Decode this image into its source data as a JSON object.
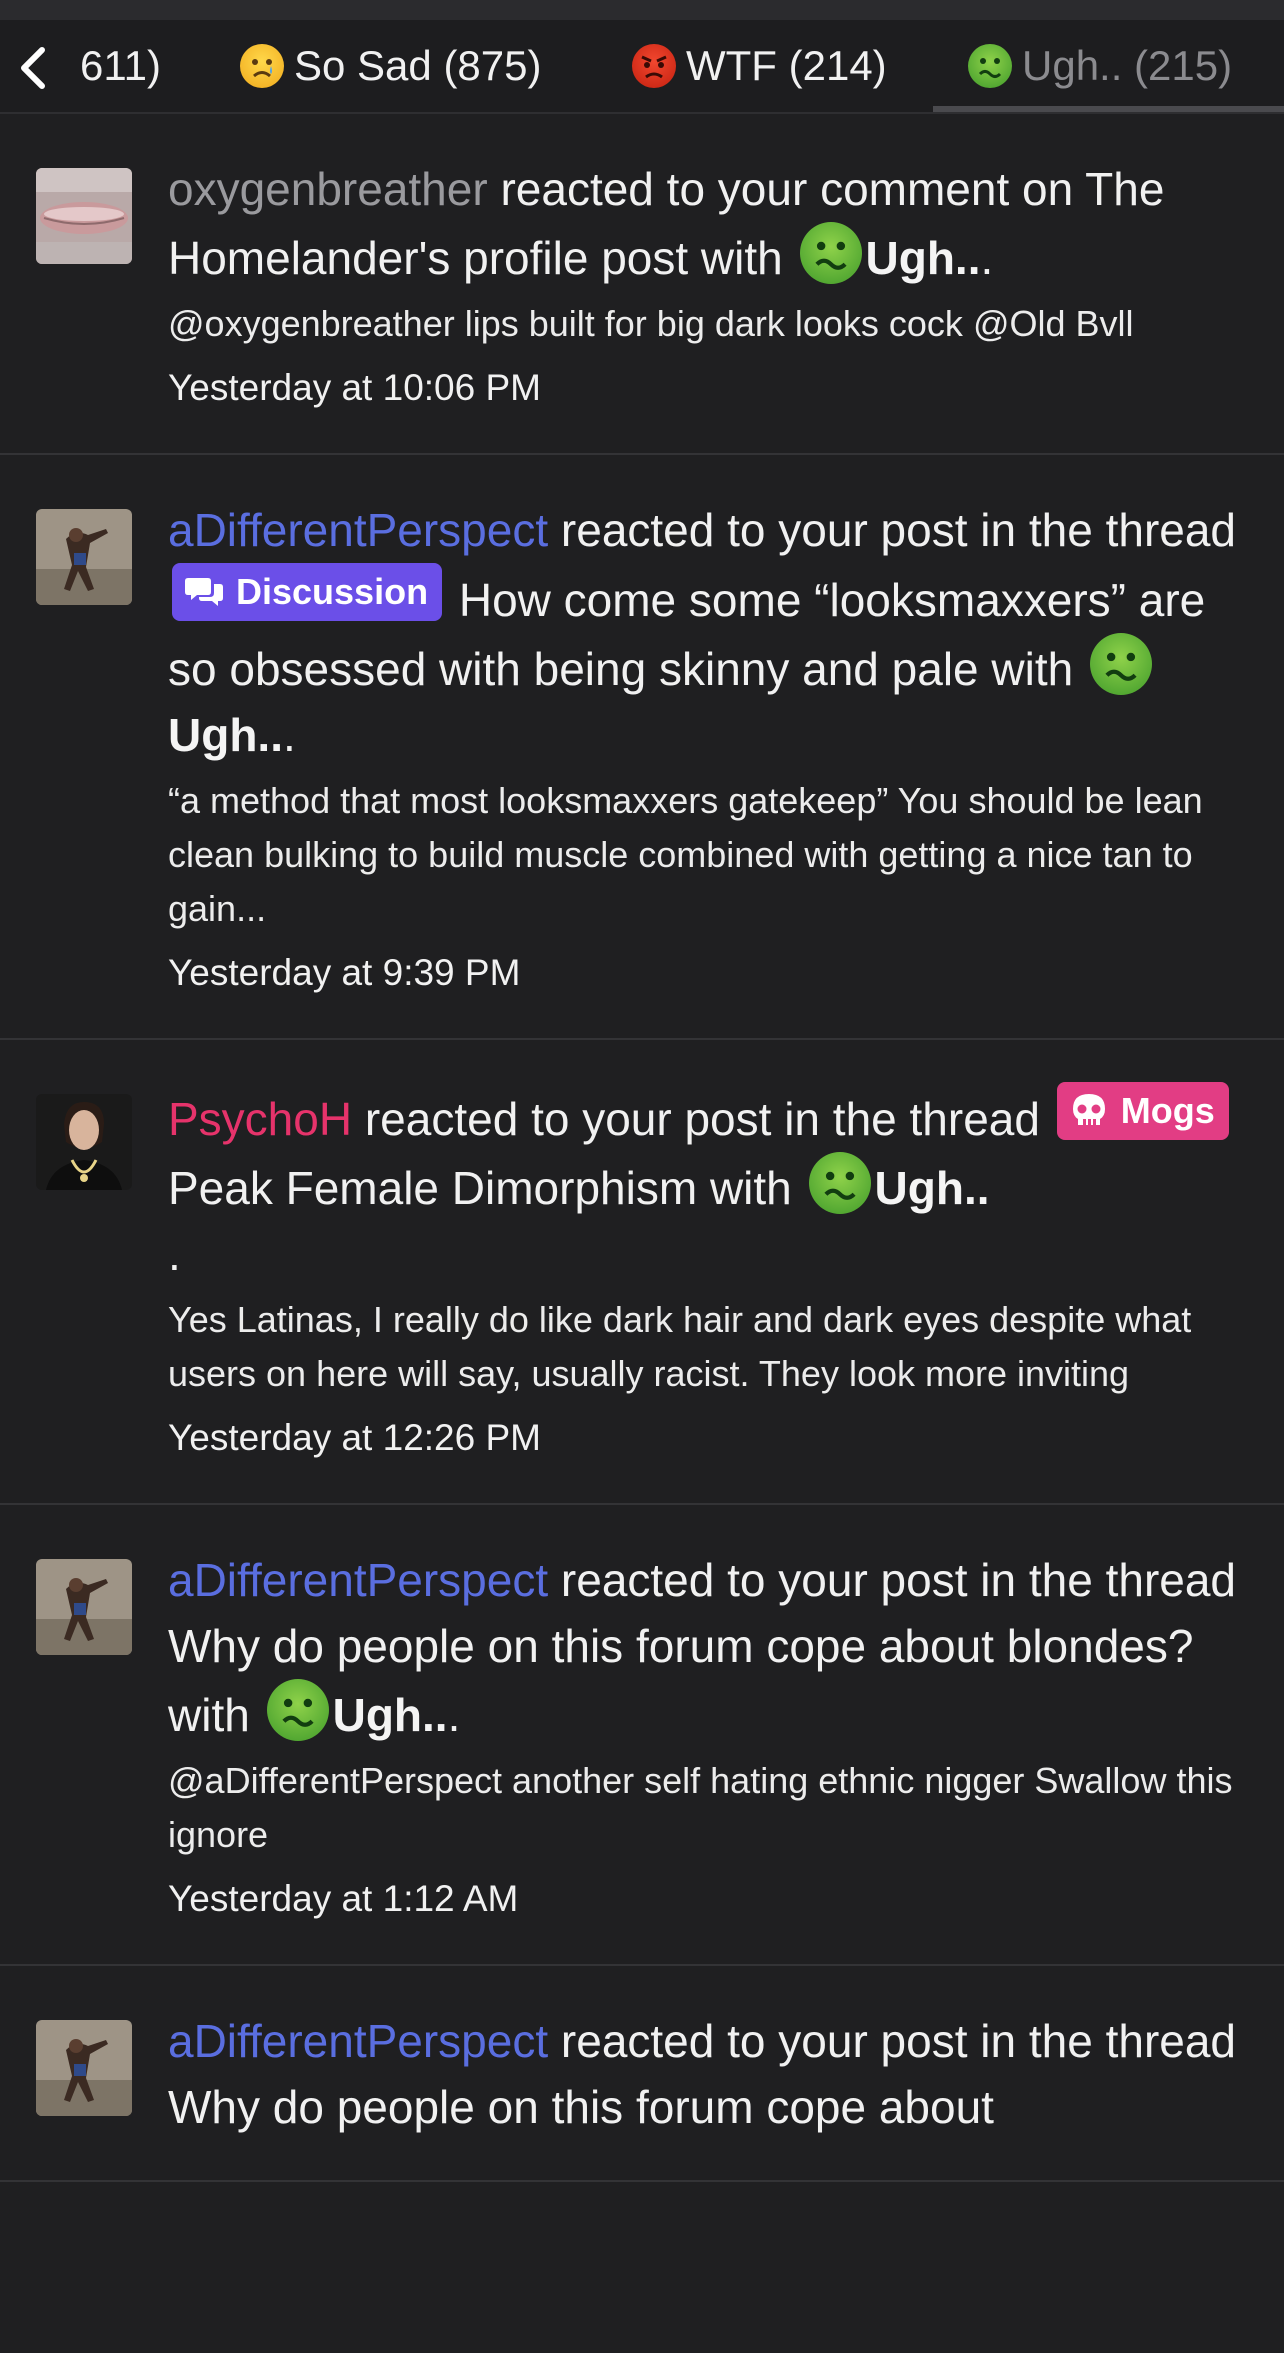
{
  "tabs": [
    {
      "label": "611)",
      "emoji": "none"
    },
    {
      "label": "So Sad (875)",
      "emoji": "sad-face-icon"
    },
    {
      "label": "WTF (214)",
      "emoji": "angry-face-icon"
    },
    {
      "label": "Ugh.. (215)",
      "emoji": "nauseated-face-icon",
      "active": true
    }
  ],
  "notifications": [
    {
      "user": "oxygenbreather",
      "text_before": "reacted to your comment on The Homelander's profile post with",
      "reaction": "Ugh..",
      "reaction_tail": ".",
      "snippet": "@oxygenbreather lips built for big dark looks cock @Old Bvll",
      "time": "Yesterday at 10:06 PM"
    },
    {
      "user": "aDifferentPerspect",
      "text_before": "reacted to your post in the thread",
      "prefix": "Discussion",
      "thread": "How come some “looksmaxxers” are so obsessed with being skinny and pale with",
      "reaction": "Ugh..",
      "reaction_tail": ".",
      "snippet": "“a method that most looksmaxxers gatekeep” You should be lean clean bulking to build muscle combined with getting a nice tan to gain...",
      "time": "Yesterday at 9:39 PM"
    },
    {
      "user": "PsychoH",
      "text_before": "reacted to your post in the thread",
      "prefix": "Mogs",
      "thread": "Peak Female Dimorphism with",
      "reaction": "Ugh..",
      "reaction_tail": ".",
      "snippet": "Yes Latinas, I really do like dark hair and dark eyes despite what users on here will say, usually racist. They look more inviting",
      "time": "Yesterday at 12:26 PM"
    },
    {
      "user": "aDifferentPerspect",
      "text_before": "reacted to your post in the thread Why do people on this forum cope about blondes? with",
      "reaction": "Ugh..",
      "reaction_tail": ".",
      "snippet": "@aDifferentPerspect another self hating ethnic nigger Swallow this ignore",
      "time": "Yesterday at 1:12 AM"
    },
    {
      "user": "aDifferentPerspect",
      "text_before": "reacted to your post in the thread Why do people on this forum cope about"
    }
  ],
  "colors": {
    "background": "#1f1f21",
    "username_grey": "#9a9a9e",
    "username_blue": "#5a6ee0",
    "username_pink": "#e6336b",
    "prefix_discussion": "#6b4fe8",
    "prefix_mogs": "#e23d84"
  }
}
